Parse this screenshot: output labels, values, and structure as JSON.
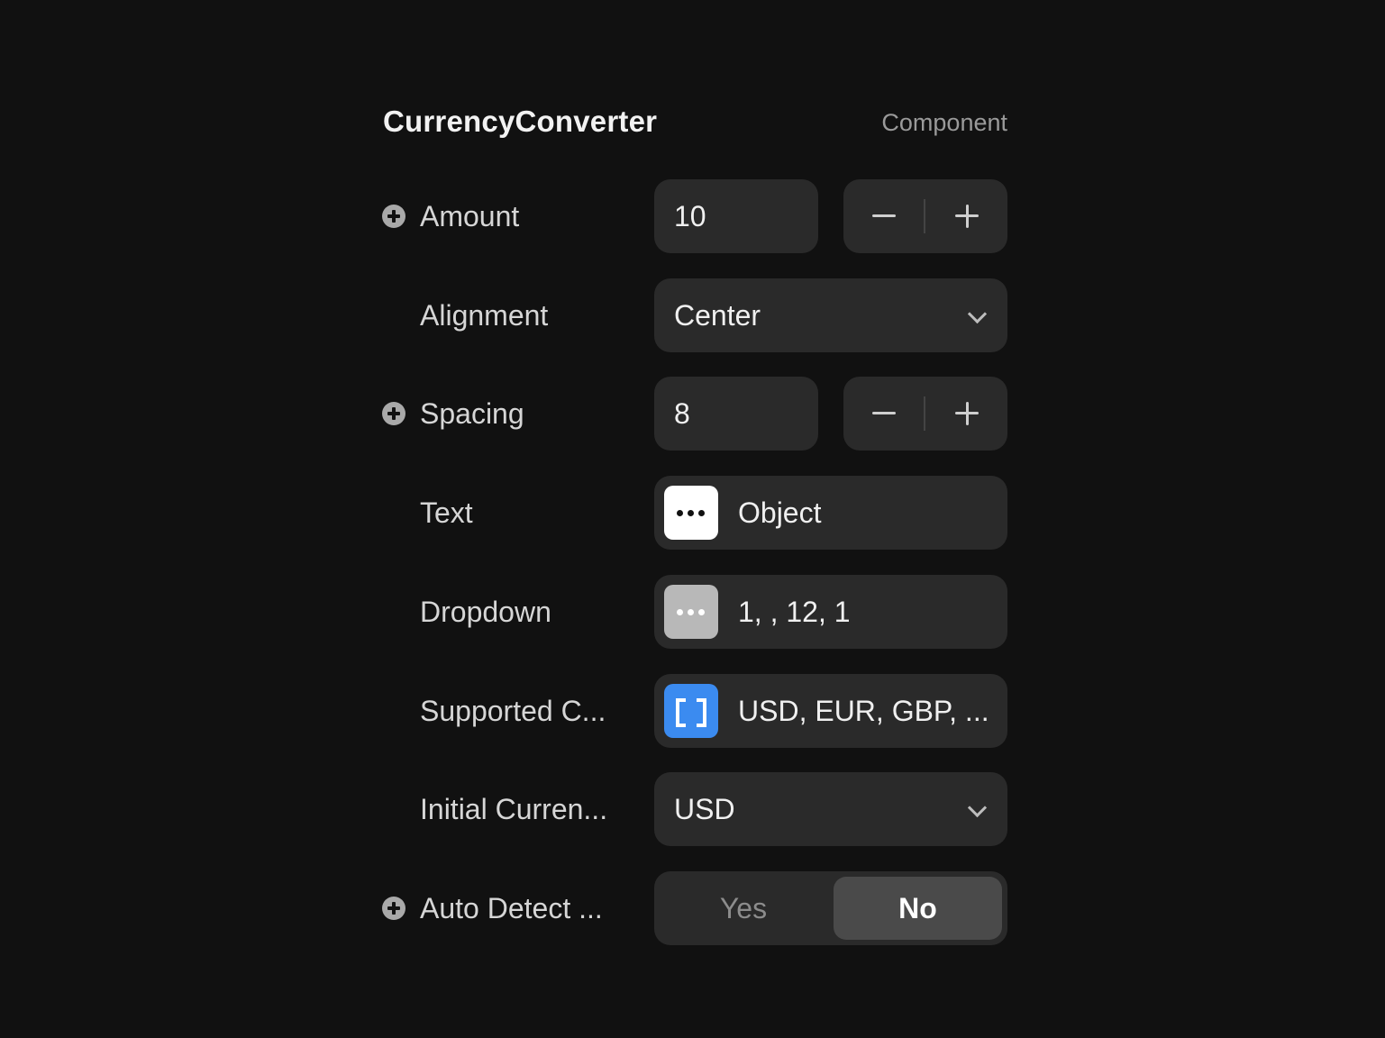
{
  "header": {
    "title": "CurrencyConverter",
    "kind": "Component"
  },
  "rows": {
    "amount": {
      "label": "Amount",
      "value": "10"
    },
    "alignment": {
      "label": "Alignment",
      "value": "Center"
    },
    "spacing": {
      "label": "Spacing",
      "value": "8"
    },
    "text": {
      "label": "Text",
      "value": "Object",
      "badge_icon": "ellipsis-icon"
    },
    "dropdown": {
      "label": "Dropdown",
      "value": "1, , 12, 1",
      "badge_icon": "ellipsis-icon"
    },
    "supported": {
      "label": "Supported C...",
      "value": "USD, EUR, GBP, ...",
      "badge_icon": "array-brackets-icon"
    },
    "initial": {
      "label": "Initial Curren...",
      "value": "USD"
    },
    "auto_detect": {
      "label": "Auto Detect ...",
      "yes": "Yes",
      "no": "No",
      "selected": "No"
    }
  },
  "colors": {
    "background": "#111111",
    "field": "#2a2a2a",
    "array_badge": "#3b8bf0",
    "toggle_active": "#4a4a4a"
  }
}
